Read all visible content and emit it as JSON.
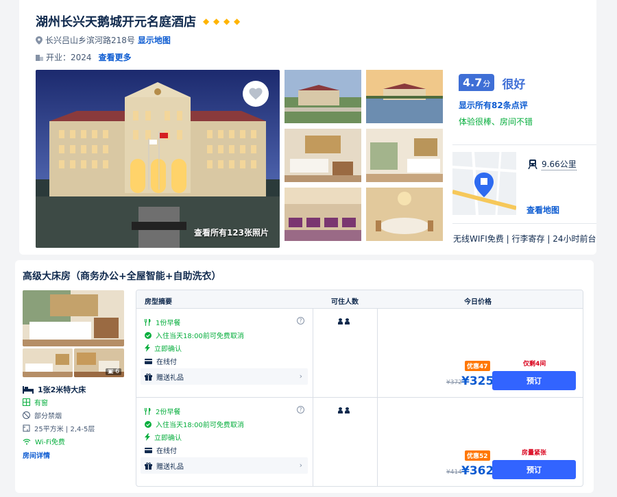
{
  "hotel": {
    "name": "湖州长兴天鹅城开元名庭酒店",
    "star_count": 4,
    "address": "长兴吕山乡滨河路218号",
    "show_map": "显示地图",
    "opened_label": "开业：2024",
    "see_more": "查看更多",
    "photo_count_label": "查看所有123张照片"
  },
  "rating": {
    "score": "4.7",
    "unit": "分",
    "word": "很好",
    "reviews_link": "显示所有82条点评",
    "quote": "体验很棒、房间不错"
  },
  "location": {
    "distance": "9.66公里",
    "map_link": "查看地图"
  },
  "amenities": "无线WIFI免费 | 行李寄存 | 24小时前台",
  "room": {
    "title": "高级大床房（商务办公+全屋智能+自助洗衣）",
    "photo_more": "6",
    "bed": "1张2米特大床",
    "features": [
      "有窗",
      "部分禁烟",
      "25平方米 | 2,4-5层",
      "Wi-Fi免费"
    ],
    "detail_link": "房间详情"
  },
  "table": {
    "headers": [
      "房型摘要",
      "可住人数",
      "今日价格"
    ],
    "rows": [
      {
        "breakfast": "1份早餐",
        "cancel": "入住当天18:00前可免费取消",
        "confirm": "立即确认",
        "pay": "在线付",
        "gift": "赠送礼品",
        "promo": "优惠47",
        "scarcity": "仅剩4间",
        "old_price": "¥372",
        "new_price": "¥325",
        "book": "预订"
      },
      {
        "breakfast": "2份早餐",
        "cancel": "入住当天18:00前可免费取消",
        "confirm": "立即确认",
        "pay": "在线付",
        "gift": "赠送礼品",
        "promo": "优惠52",
        "scarcity": "房量紧张",
        "old_price": "¥414",
        "new_price": "¥362",
        "book": "预订"
      }
    ]
  },
  "colors": {
    "link_blue": "#0c5bd1",
    "score_blue": "#3f6fd6",
    "green": "#06ae3d",
    "star_gold": "#ffb400",
    "promo_orange": "#ff7700",
    "book_blue": "#3264ff",
    "scarcity_red": "#d9001b"
  }
}
